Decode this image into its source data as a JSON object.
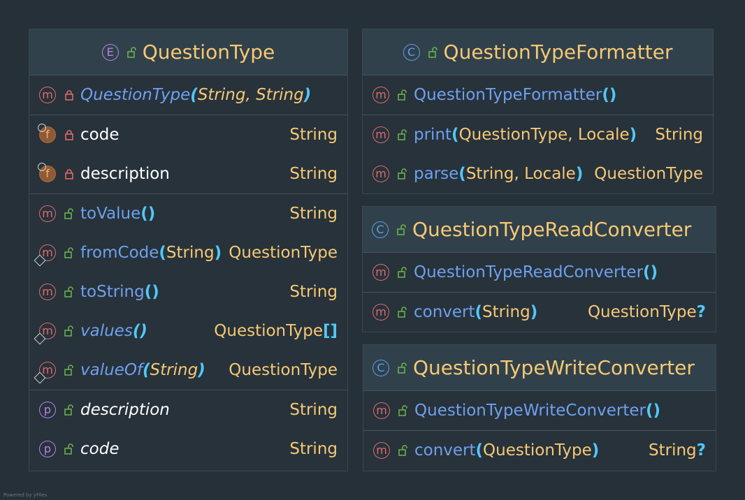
{
  "diagram": {
    "classes": [
      {
        "id": "question-type",
        "badge": "E",
        "title": "QuestionType",
        "constructors": [
          {
            "name": "QuestionType",
            "open": "(",
            "params": "String, String",
            "close": ")",
            "type": ""
          }
        ],
        "fields": [
          {
            "name": "code",
            "type": "String"
          },
          {
            "name": "description",
            "type": "String"
          }
        ],
        "methods": [
          {
            "name": "toValue",
            "open": "(",
            "params": "",
            "close": ")",
            "type": "String",
            "static": false,
            "italic": false
          },
          {
            "name": "fromCode",
            "open": "(",
            "params": "String",
            "close": ")",
            "type": "QuestionType",
            "static": true,
            "italic": false
          },
          {
            "name": "toString",
            "open": "(",
            "params": "",
            "close": ")",
            "type": "String",
            "static": false,
            "italic": false
          },
          {
            "name": "values",
            "open": "(",
            "params": "",
            "close": ")",
            "type": "QuestionType",
            "type_suffix": "[]",
            "static": true,
            "italic": true
          },
          {
            "name": "valueOf",
            "open": "(",
            "params": "String",
            "close": ")",
            "type": "QuestionType",
            "static": true,
            "italic": true
          }
        ],
        "properties": [
          {
            "name": "description",
            "type": "String"
          },
          {
            "name": "code",
            "type": "String"
          }
        ]
      },
      {
        "id": "question-type-formatter",
        "badge": "C",
        "title": "QuestionTypeFormatter",
        "methods": [
          {
            "name": "QuestionTypeFormatter",
            "open": "(",
            "params": "",
            "close": ")",
            "type": ""
          },
          {
            "name": "print",
            "open": "(",
            "params": "QuestionType, Locale",
            "close": ")",
            "type": "String"
          },
          {
            "name": "parse",
            "open": "(",
            "params": "String, Locale",
            "close": ")",
            "type": "QuestionType"
          }
        ]
      },
      {
        "id": "question-type-read-converter",
        "badge": "C",
        "title": "QuestionTypeReadConverter",
        "constructors": [
          {
            "name": "QuestionTypeReadConverter",
            "open": "(",
            "params": "",
            "close": ")",
            "type": ""
          }
        ],
        "methods": [
          {
            "name": "convert",
            "open": "(",
            "params": "String",
            "close": ")",
            "type": "QuestionType",
            "type_suffix": "?"
          }
        ]
      },
      {
        "id": "question-type-write-converter",
        "badge": "C",
        "title": "QuestionTypeWriteConverter",
        "constructors": [
          {
            "name": "QuestionTypeWriteConverter",
            "open": "(",
            "params": "",
            "close": ")",
            "type": ""
          }
        ],
        "methods": [
          {
            "name": "convert",
            "open": "(",
            "params": "QuestionType",
            "close": ")",
            "type": "String",
            "type_suffix": "?"
          }
        ]
      }
    ],
    "badge_letters": {
      "method": "m",
      "field": "f",
      "property": "p"
    },
    "footer": "Powered by yFiles",
    "colors": {
      "background": "#263039",
      "header": "#30414b",
      "title": "#f7c874",
      "method": "#6fa0ec",
      "type": "#f7c874",
      "paren": "#52c8f7",
      "method_badge": "#e06a6a",
      "enum_badge": "#b883e0",
      "class_badge": "#5e9eec",
      "public_icon": "#6ab04c",
      "private_icon": "#e06a6a"
    },
    "icons": {
      "public": "unlocked-padlock-icon",
      "private": "locked-padlock-icon",
      "static": "diamond-static-icon",
      "final": "key-final-icon"
    }
  }
}
